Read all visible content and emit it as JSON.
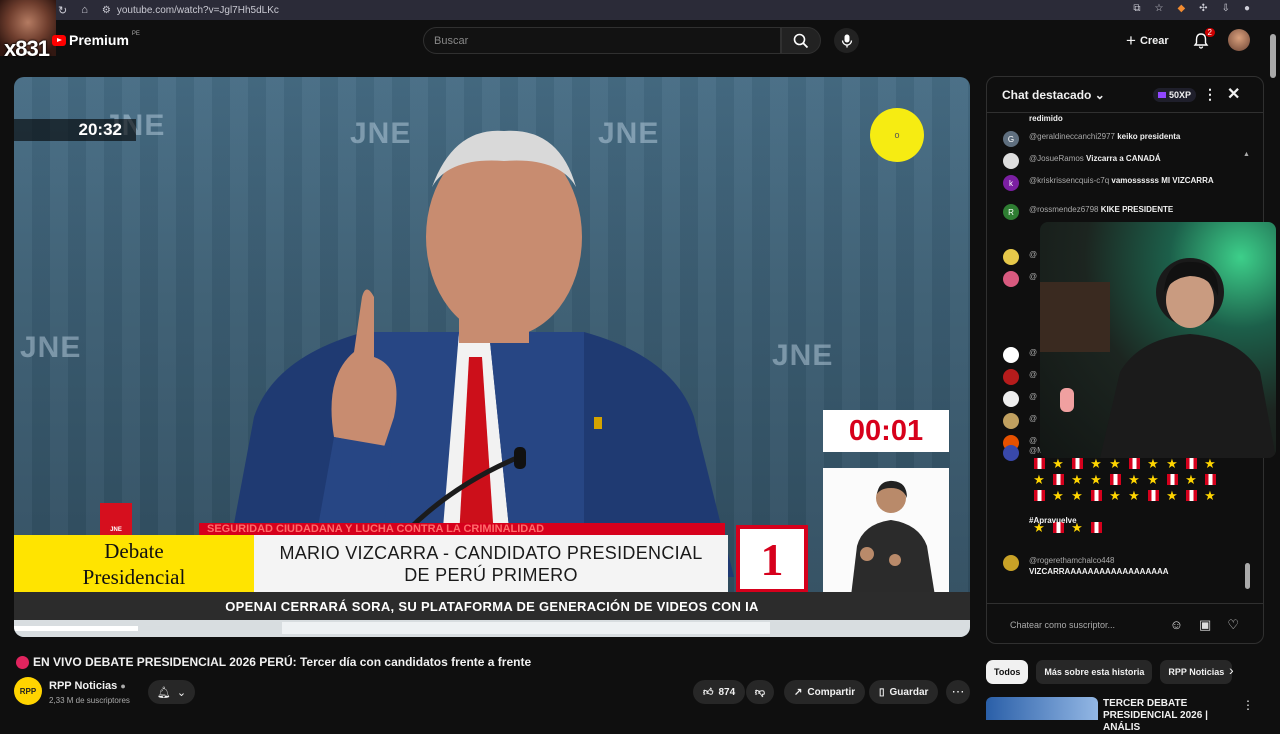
{
  "browser": {
    "url": "youtube.com/watch?v=Jgl7Hh5dLKc"
  },
  "overlay": {
    "streamer_tag": "x831"
  },
  "header": {
    "logo_text": "Premium",
    "logo_region": "PE",
    "search_placeholder": "Buscar",
    "create_label": "Crear",
    "notification_count": "2"
  },
  "player": {
    "stream_time": "20:32",
    "cursor_label": "o",
    "backdrop_word": "JNE",
    "countdown": "00:01",
    "jne_logo": "JNE",
    "topic_strip": "SEGURIDAD CIUDADANA Y LUCHA CONTRA LA CRIMINALIDAD",
    "debate_line1": "Debate",
    "debate_line2": "Presidencial",
    "candidate_line1": "MARIO VIZCARRA - CANDIDATO PRESIDENCIAL",
    "candidate_line2": "DE PERÚ PRIMERO",
    "party_number": "1",
    "ticker": "OPENAI CERRARÁ SORA, SU PLATAFORMA DE GENERACIÓN DE VIDEOS CON IA"
  },
  "video": {
    "title": "EN VIVO DEBATE PRESIDENCIAL 2026 PERÚ: Tercer día con candidatos frente a frente",
    "channel_name": "RPP Noticias",
    "channel_avatar": "RPP",
    "subscribers": "2,33 M de suscriptores",
    "likes": "874",
    "share_label": "Compartir",
    "save_label": "Guardar"
  },
  "chat": {
    "title": "Chat destacado",
    "points": "50XP",
    "input_placeholder": "Chatear como suscriptor...",
    "messages": [
      {
        "user": "",
        "text": "redimido",
        "initial": "",
        "color": "#555555"
      },
      {
        "user": "@geraldineccanchi2977",
        "text": "keiko presidenta",
        "initial": "G",
        "color": "#5f6f7f"
      },
      {
        "user": "@JosueRamos",
        "text": "Vizcarra a CANADÁ",
        "initial": "",
        "color": "#dddddd"
      },
      {
        "user": "@kriskrissencquis-c7q",
        "text": "vamossssss MI VIZCARRA",
        "initial": "k",
        "color": "#7b1fa2"
      },
      {
        "user": "@rossmendez6798",
        "text": "KIKE PRESIDENTE",
        "initial": "R",
        "color": "#2e7d32"
      },
      {
        "user": "@rogerethamchalco448",
        "text": "VIZCARRAAAAAAAAAAAAAAAAAA",
        "initial": "",
        "color": "#c9a227"
      }
    ],
    "stub_avatars": [
      "#e6c84a",
      "#d85a7f",
      "#ffffff",
      "#b71c1c",
      "#eeeeee",
      "#c0a060",
      "#e65100",
      "#3949ab"
    ],
    "stub_users": [
      "@",
      "@",
      "@",
      "@",
      "@",
      "@",
      "@",
      "@M"
    ],
    "stars_caption": "#Apravuelve"
  },
  "recommendations": {
    "chips": [
      "Todos",
      "Más sobre esta historia",
      "RPP Noticias"
    ],
    "first_title": "TERCER DEBATE PRESIDENCIAL 2026 | ANÁLIS"
  },
  "colors": {
    "youtube_red": "#ff0000",
    "debate_yellow": "#ffe400",
    "peru_red": "#d6001c",
    "cursor_yellow": "#f6ec12"
  }
}
